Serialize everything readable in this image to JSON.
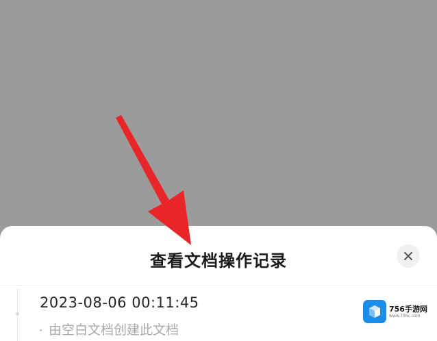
{
  "sheet": {
    "title": "查看文档操作记录",
    "close_icon": "close-icon"
  },
  "records": [
    {
      "time": "2023-08-06 00:11:45",
      "description": "由空白文档创建此文档"
    }
  ],
  "annotation": {
    "arrow_color": "#e8262a",
    "arrow_icon": "red-pointer-arrow"
  },
  "watermark": {
    "name": "756手游网",
    "url": "www.756c.com",
    "accent": "#1a8ee8"
  },
  "colors": {
    "backdrop": "#9c9c9c",
    "sheet": "#ffffff"
  }
}
